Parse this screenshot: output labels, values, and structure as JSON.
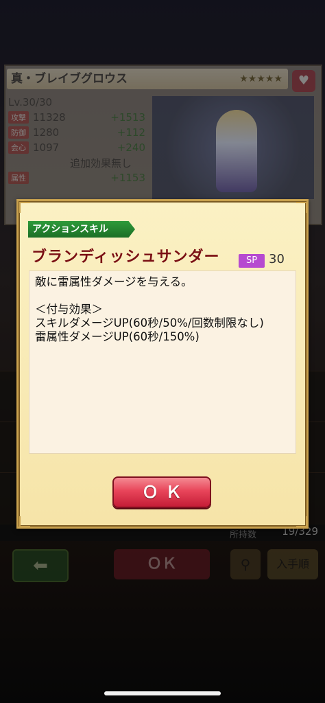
{
  "background": {
    "card_title": "真・ブレイブグロウス",
    "stars": "★★★★★",
    "level": "Lv.30/30",
    "stats": [
      {
        "tag": "攻撃",
        "value": "11328",
        "plus": "+1513"
      },
      {
        "tag": "防御",
        "value": "1280",
        "plus": "+112"
      },
      {
        "tag": "会心",
        "value": "1097",
        "plus": "+240"
      },
      {
        "tag": "",
        "value": "追加効果無し",
        "plus": ""
      },
      {
        "tag": "属性",
        "value": "",
        "plus": "+1153"
      }
    ],
    "count_label": "所持数",
    "count_value": "19/329",
    "back_icon": "back-arrow-icon",
    "ok_dim_label": "ＯＫ",
    "sort_label": "入手順"
  },
  "dialog": {
    "tag": "アクションスキル",
    "skill_name": "ブランディッシュサンダー",
    "sp_label": "SP",
    "sp_value": "30",
    "description": "敵に雷属性ダメージを与える。\n\n＜付与効果＞\nスキルダメージUP(60秒/50%/回数制限なし)\n雷属性ダメージUP(60秒/150%)",
    "ok_label": "ＯＫ"
  },
  "colors": {
    "skill_name": "#7a0f14",
    "tag_green": "#2e9a3a",
    "sp_purple": "#b64ad0",
    "ok_red": "#e8455a"
  }
}
